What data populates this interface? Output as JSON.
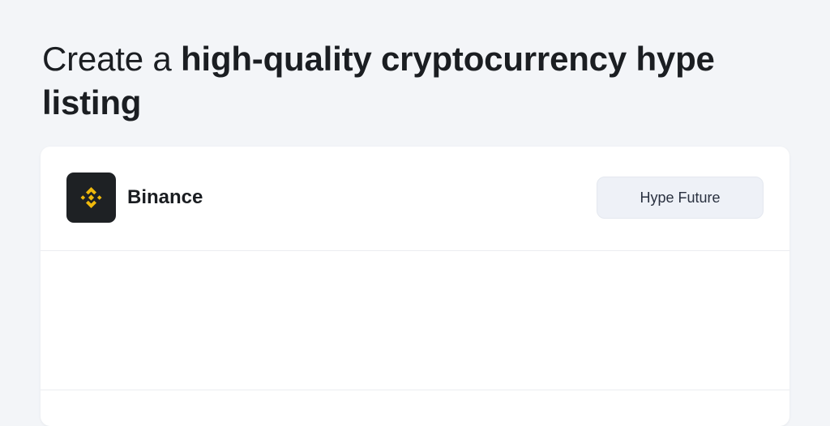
{
  "page": {
    "title_lead": "Create a ",
    "title_emphasis": "high-quality cryptocurrency hype listing"
  },
  "listing": {
    "exchange_name": "Binance",
    "logo_icon": "binance-logo-icon",
    "action_label": "Hype Future"
  },
  "colors": {
    "page_background": "#f3f5f8",
    "card_background": "#ffffff",
    "logo_background": "#1e2124",
    "brand_accent": "#f0b90b",
    "button_background": "#eef1f7"
  }
}
